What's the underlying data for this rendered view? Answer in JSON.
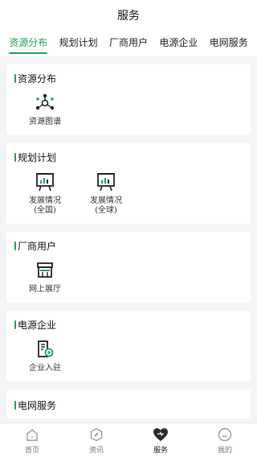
{
  "header": {
    "title": "服务"
  },
  "tabs": [
    {
      "label": "资源分布",
      "active": true
    },
    {
      "label": "规划计划",
      "active": false
    },
    {
      "label": "厂商用户",
      "active": false
    },
    {
      "label": "电源企业",
      "active": false
    },
    {
      "label": "电网服务",
      "active": false
    }
  ],
  "sections": [
    {
      "title": "资源分布",
      "items": [
        {
          "label": "资源图谱",
          "icon": "network-graph-icon"
        }
      ]
    },
    {
      "title": "规划计划",
      "items": [
        {
          "label": "发展情况\n(全国)",
          "icon": "presentation-chart-icon"
        },
        {
          "label": "发展情况\n(全球)",
          "icon": "presentation-chart-icon"
        }
      ]
    },
    {
      "title": "厂商用户",
      "items": [
        {
          "label": "网上展厅",
          "icon": "storefront-icon"
        }
      ]
    },
    {
      "title": "电源企业",
      "items": [
        {
          "label": "企业入驻",
          "icon": "building-add-icon"
        }
      ]
    },
    {
      "title": "电网服务",
      "items": []
    }
  ],
  "bottom_nav": [
    {
      "label": "首页",
      "icon": "home-icon",
      "active": false
    },
    {
      "label": "资讯",
      "icon": "compass-icon",
      "active": false
    },
    {
      "label": "服务",
      "icon": "heart-icon",
      "active": true
    },
    {
      "label": "我的",
      "icon": "profile-icon",
      "active": false
    }
  ],
  "colors": {
    "accent": "#21a05a",
    "background": "#f4f5f7"
  }
}
